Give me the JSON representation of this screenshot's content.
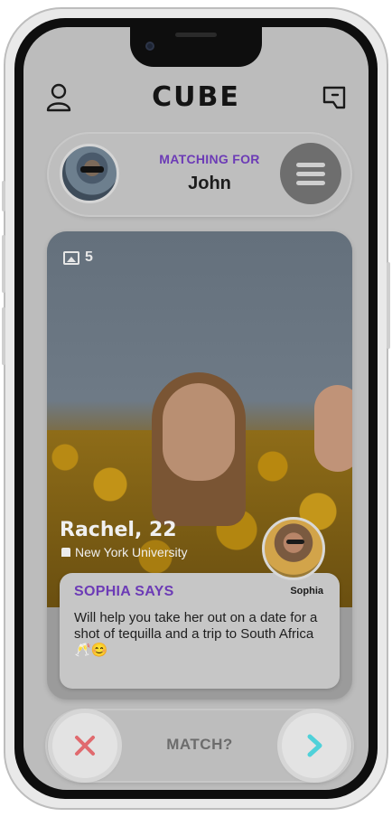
{
  "app": {
    "title": "CUBE"
  },
  "header": {
    "profile_icon": "user-icon",
    "chat_icon": "message-square-icon"
  },
  "matching": {
    "label": "MATCHING FOR",
    "name": "John",
    "menu_icon": "hamburger-menu-icon"
  },
  "profile": {
    "photo_count": "5",
    "name_age": "Rachel, 22",
    "school": "New York University"
  },
  "recommendation": {
    "title": "SOPHIA SAYS",
    "author": "Sophia",
    "text": "Will help you take her out on a date for a shot of tequilla and a trip to South Africa 🥂😊"
  },
  "actions": {
    "reject_icon": "close-x-icon",
    "accept_icon": "chevron-right-icon",
    "match_label": "MATCH?"
  },
  "colors": {
    "accent_purple": "#6c3bb6",
    "reject_red": "#e06a6e",
    "accept_cyan": "#4fd1d9",
    "overlay_gray": "#bcbcbc"
  }
}
